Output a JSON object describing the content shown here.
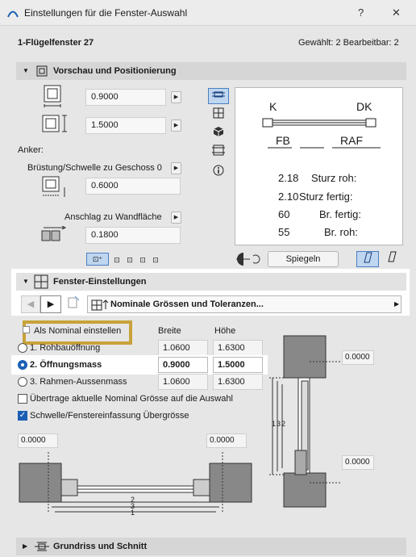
{
  "window": {
    "title": "Einstellungen für die Fenster-Auswahl",
    "help": "?",
    "close": "✕"
  },
  "header": {
    "element_name": "1-Flügelfenster 27",
    "selection_info": "Gewählt: 2 Bearbeitbar: 2"
  },
  "preview_section": {
    "title": "Vorschau und Positionierung",
    "width_value": "0.9000",
    "height_value": "1.5000",
    "anchor_label": "Anker:",
    "sill_label": "Brüstung/Schwelle zu Geschoss 0",
    "sill_value": "0.6000",
    "reveal_label": "Anschlag zu Wandfläche",
    "reveal_value": "0.1800",
    "mirror_button": "Spiegeln",
    "preview_labels": {
      "k": "K",
      "dk": "DK",
      "fb": "FB",
      "raf": "RAF",
      "rows": [
        {
          "value": "2.18",
          "label": "Sturz roh:"
        },
        {
          "value": "2.10",
          "label": "Sturz fertig:"
        },
        {
          "value": "60",
          "label": "Br. fertig:"
        },
        {
          "value": "55",
          "label": "Br. roh:"
        }
      ]
    }
  },
  "window_settings": {
    "title": "Fenster-Einstellungen",
    "page_label": "Nominale Grössen und Toleranzen...",
    "nominal_label": "Als Nominal einstellen",
    "col_width": "Breite",
    "col_height": "Höhe",
    "rows": [
      {
        "label": "1. Rohbauöffnung",
        "width": "1.0600",
        "height": "1.6300"
      },
      {
        "label": "2. Öffnungsmass",
        "width": "0.9000",
        "height": "1.5000"
      },
      {
        "label": "3. Rahmen-Aussenmass",
        "width": "1.0600",
        "height": "1.6300"
      }
    ],
    "transfer_label": "Übertrage aktuelle Nominal Grösse auf die Auswahl",
    "oversize_label": "Schwelle/Fenstereinfassung Übergrösse",
    "tolerance_right_top": "0.0000",
    "tolerance_right_bottom": "0.0000",
    "tolerance_left": "0.0000",
    "tolerance_right": "0.0000",
    "dim_labels": {
      "one": "1",
      "two": "2",
      "three": "3"
    }
  },
  "floor_section": {
    "title": "Grundriss und Schnitt"
  },
  "colors": {
    "accent": "#1a5fb4",
    "highlight_box": "#c8a23a"
  }
}
